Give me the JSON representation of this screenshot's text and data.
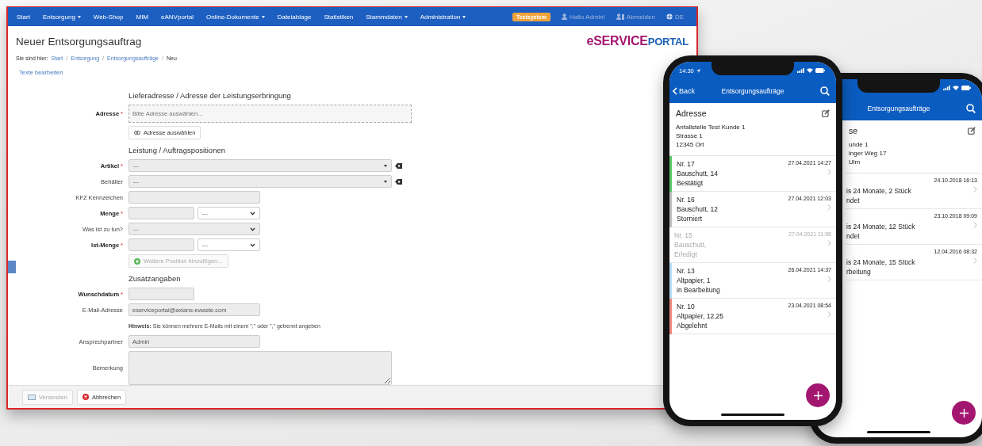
{
  "web_window": {
    "nav": [
      {
        "label": "Start",
        "dropdown": false
      },
      {
        "label": "Entsorgung",
        "dropdown": true
      },
      {
        "label": "Web-Shop",
        "dropdown": false
      },
      {
        "label": "MIM",
        "dropdown": false
      },
      {
        "label": "eANVportal",
        "dropdown": false
      },
      {
        "label": "Online-Dokumente",
        "dropdown": true
      },
      {
        "label": "Dateiablage",
        "dropdown": false
      },
      {
        "label": "Statistiken",
        "dropdown": false
      },
      {
        "label": "Stammdaten",
        "dropdown": true
      },
      {
        "label": "Administration",
        "dropdown": true
      }
    ],
    "system_badge": "Testsystem",
    "user_links": [
      {
        "kind": "user",
        "label": "Hallo Admin!"
      },
      {
        "kind": "logout",
        "label": "Abmelden"
      },
      {
        "kind": "language",
        "label": "DE"
      }
    ],
    "page_title": "Neuer Entsorgungsauftrag",
    "logo": {
      "prefix": "eSERVICE",
      "suffix": "PORTAL"
    },
    "breadcrumb": {
      "label": "Sie sind hier:",
      "items": [
        "Start",
        "Entsorgung",
        "Entsorgungsaufträge",
        "Neu"
      ],
      "separators": [
        "/",
        "/",
        "/"
      ]
    },
    "edit_texts_link": "Texte bearbeiten",
    "form": [
      {
        "kind": "heading",
        "text": "Lieferadresse / Adresse der Leistungserbringung"
      },
      {
        "kind": "address",
        "label": "Adresse",
        "required": true,
        "asterisk": "*",
        "placeholder": "Bitte Adresse auswählen..."
      },
      {
        "kind": "choose_button",
        "label": "Adresse auswählen",
        "disabled": false
      },
      {
        "kind": "heading",
        "text": "Leistung / Auftragspositionen"
      },
      {
        "kind": "wide_select",
        "label": "Artikel",
        "required": true,
        "asterisk": "*",
        "value": "---"
      },
      {
        "kind": "wide_select",
        "label": "Behälter",
        "required": false,
        "value": "---"
      },
      {
        "kind": "input",
        "label": "KFZ Kennzeichen",
        "required": false
      },
      {
        "kind": "amount",
        "label": "Menge",
        "required": true,
        "asterisk": "*",
        "unit": "---"
      },
      {
        "kind": "select",
        "label": "Was ist zu tun?",
        "required": false,
        "value": "---"
      },
      {
        "kind": "amount",
        "label": "Ist-Menge",
        "required": true,
        "asterisk": "*",
        "unit": "---"
      },
      {
        "kind": "add_button",
        "label": "Weitere Position hinzufügen...",
        "disabled": true
      },
      {
        "kind": "heading",
        "text": "Zusatzangaben"
      },
      {
        "kind": "short_input",
        "label": "Wunschdatum",
        "required": true,
        "asterisk": "*"
      },
      {
        "kind": "input",
        "label": "E-Mail-Adresse",
        "required": false,
        "value": "eserviceportal@axians-ewaste.com"
      },
      {
        "kind": "hint",
        "text": "**Hinweis:** Sie können mehrere E-Mails mit einem \";\" oder \",\" getrennt angeben"
      },
      {
        "kind": "input",
        "label": "Ansprechpartner",
        "required": false,
        "value": "Admin"
      },
      {
        "kind": "textarea",
        "label": "Bemerkung",
        "required": false
      }
    ],
    "footer_buttons": [
      {
        "kind": "send",
        "label": "Versenden",
        "disabled": true
      },
      {
        "kind": "cancel",
        "label": "Abbrechen",
        "disabled": false
      }
    ]
  },
  "phones": [
    {
      "time": "14:30",
      "back": "Back",
      "title": "Entsorgungsaufträge",
      "address": {
        "heading": "Adresse",
        "lines": [
          "Anfallstelle Test Kunde 1",
          "Strasse 1",
          "12345 Ort"
        ]
      },
      "orders": [
        {
          "number": "Nr. 17",
          "material": "Bauschutt, 14",
          "status": "Bestätigt",
          "date": "27.04.2021 14:27",
          "color": "#5cc86a",
          "dimmed": false
        },
        {
          "number": "Nr. 16",
          "material": "Bauschutt, 12",
          "status": "Storniert",
          "date": "27.04.2021 12:03",
          "color": "#bdbdbd",
          "dimmed": false
        },
        {
          "number": "Nr. 15",
          "material": "Bauschutt,",
          "status": "Erledigt",
          "date": "27.04.2021 11:58",
          "dimmed": true
        },
        {
          "number": "Nr. 13",
          "material": "Altpapier, 1",
          "status": "in Bearbeitung",
          "date": "26.04.2021 14:37",
          "color": "#b8dcf6",
          "dimmed": false
        },
        {
          "number": "Nr. 10",
          "material": "Altpapier, 12,25",
          "status": "Abgelehnt",
          "date": "23.04.2021 08:54",
          "color": "#f08a80",
          "dimmed": false
        }
      ]
    },
    {
      "title": "Entsorgungsaufträge",
      "address": {
        "heading": "se",
        "lines": [
          "unde 1",
          "inger Weg 17",
          "Ulm"
        ]
      },
      "orders": [
        {
          "material": "is 24 Monate, 2 Stück",
          "status": "ndet",
          "date": "24.10.2018 16:13"
        },
        {
          "material": "is 24 Monate, 12 Stück",
          "status": "ndet",
          "date": "23.10.2018 09:09"
        },
        {
          "material": "is 24 Monate, 15 Stück",
          "status": "rbeitung",
          "date": "12.04.2016 08:32"
        }
      ]
    }
  ]
}
